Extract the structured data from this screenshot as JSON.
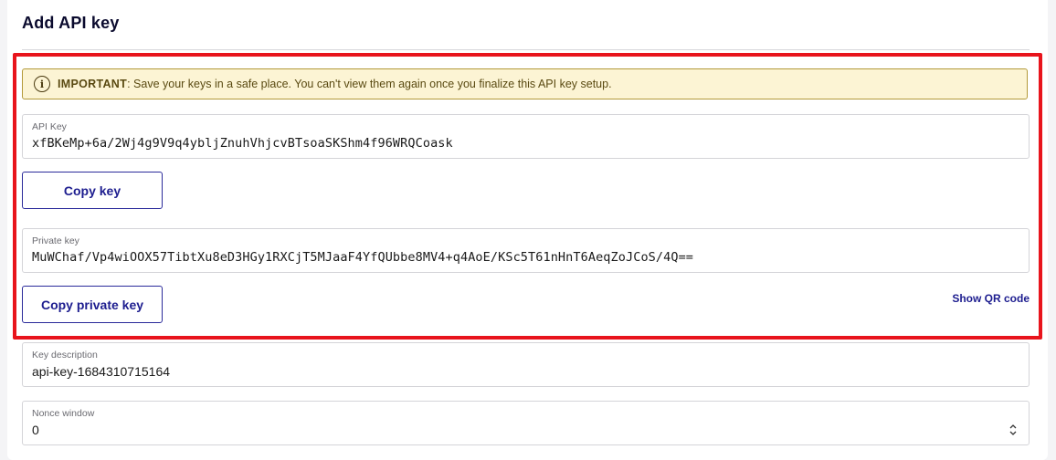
{
  "page": {
    "title": "Add API key"
  },
  "alert": {
    "icon": "info-circle-icon",
    "strong": "IMPORTANT",
    "message": ": Save your keys in a safe place. You can't view them again once you finalize this API key setup."
  },
  "api_key": {
    "label": "API Key",
    "value": "xfBKeMp+6a/2Wj4g9V9q4ybljZnuhVhjcvBTsoaSKShm4f96WRQCoask",
    "copy_label": "Copy key"
  },
  "private_key": {
    "label": "Private key",
    "value": "MuWChaf/Vp4wiOOX57TibtXu8eD3HGy1RXCjT5MJaaF4YfQUbbe8MV4+q4AoE/KSc5T61nHnT6AeqZoJCoS/4Q==",
    "copy_label": "Copy private key",
    "qr_label": "Show QR code"
  },
  "description": {
    "label": "Key description",
    "value": "api-key-1684310715164"
  },
  "nonce": {
    "label": "Nonce window",
    "value": "0"
  },
  "colors": {
    "highlight": "#e8141c",
    "accent": "#1d1d8f",
    "alert_bg": "#fcf4d4"
  }
}
